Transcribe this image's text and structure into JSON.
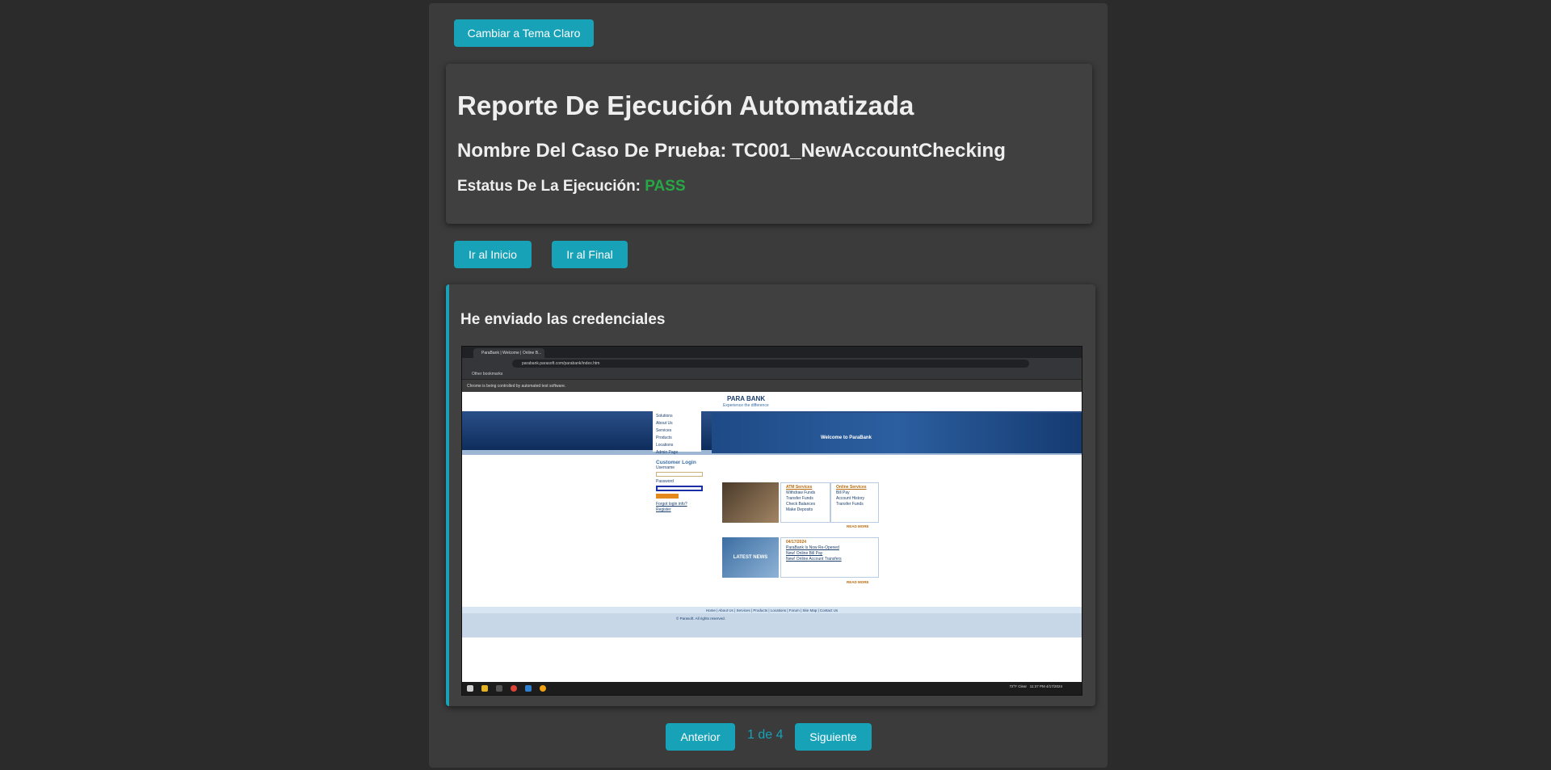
{
  "theme_toggle_label": "Cambiar a Tema Claro",
  "report": {
    "title": "Reporte De Ejecución Automatizada",
    "test_case_label": "Nombre Del Caso De Prueba: ",
    "test_case_name": "TC001_NewAccountChecking",
    "status_label": "Estatus De La Ejecución: ",
    "status_value": "PASS",
    "status_color": "#28a745"
  },
  "nav": {
    "start_label": "Ir al Inicio",
    "end_label": "Ir al Final"
  },
  "step": {
    "title": "He enviado las credenciales",
    "screenshot": {
      "tab_title": "ParaBank | Welcome | Online B...",
      "url": "parabank.parasoft.com/parabank/index.htm",
      "bookmarks": "Other bookmarks",
      "automation_notice": "Chrome is being controlled by automated test software.",
      "logo": "PARA BANK",
      "tagline": "Experience the difference",
      "menu": [
        "Solutions",
        "About Us",
        "Services",
        "Products",
        "Locations",
        "Admin Page"
      ],
      "hero_text": "Welcome to ParaBank",
      "login_title": "Customer Login",
      "username_label": "Username",
      "password_label": "Password",
      "forgot_link": "Forgot login info?",
      "register_link": "Register",
      "atm_title": "ATM Services",
      "atm_items": [
        "Withdraw Funds",
        "Transfer Funds",
        "Check Balances",
        "Make Deposits"
      ],
      "online_title": "Online Services",
      "online_items": [
        "Bill Pay",
        "Account History",
        "Transfer Funds"
      ],
      "read_more": "READ MORE",
      "news_label": "LATEST NEWS",
      "news_date": "04/17/2024",
      "news_items": [
        "ParaBank Is Now Re-Opened",
        "New! Online Bill Pay",
        "New! Online Account Transfers"
      ],
      "footer_links": "Home | About Us | Services | Products | Locations | Forum | Site Map | Contact Us",
      "copyright": "© Parasoft. All rights reserved.",
      "taskbar_weather": "72°F Clear",
      "taskbar_time": "11:37 PM",
      "taskbar_date": "4/17/2024"
    }
  },
  "pagination": {
    "prev_label": "Anterior",
    "page_text": "1 de 4",
    "next_label": "Siguiente"
  }
}
